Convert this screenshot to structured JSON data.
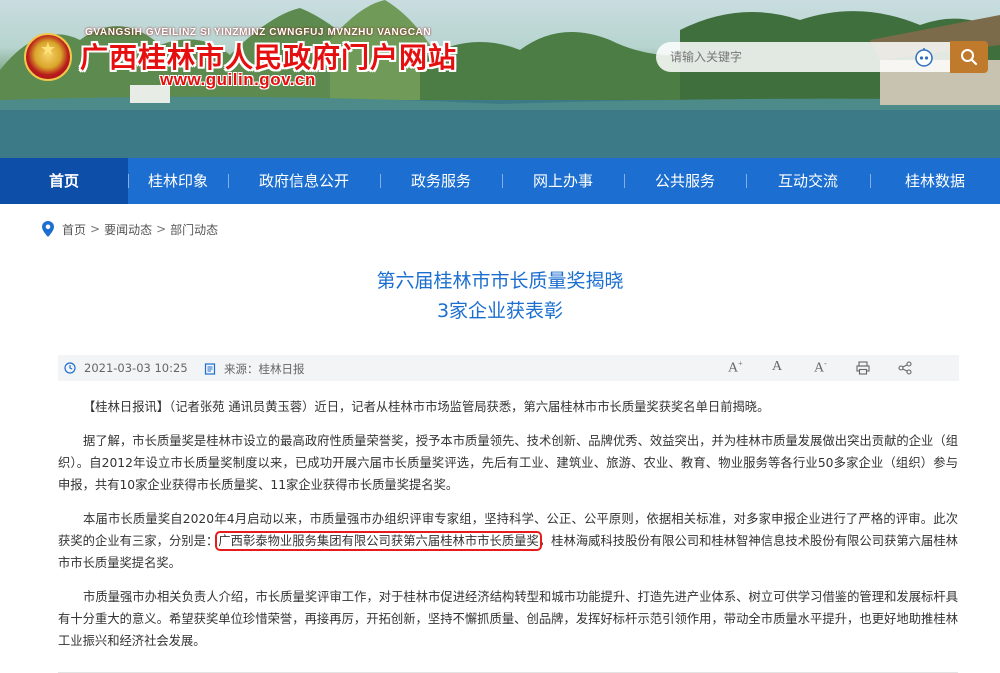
{
  "header": {
    "site_pinyin": "GVANGSIH GVEILINZ SI YINZMINZ CWNGFUJ MVNZHU VANGCAN",
    "site_title": "广西桂林市人民政府门户网站",
    "site_url": "www.guilin.gov.cn",
    "search": {
      "placeholder": "请输入关键字"
    }
  },
  "nav": {
    "items": [
      {
        "label": "首页",
        "active": true
      },
      {
        "label": "桂林印象"
      },
      {
        "label": "政府信息公开"
      },
      {
        "label": "政务服务"
      },
      {
        "label": "网上办事"
      },
      {
        "label": "公共服务"
      },
      {
        "label": "互动交流"
      },
      {
        "label": "桂林数据"
      }
    ]
  },
  "breadcrumb": [
    "首页",
    "要闻动态",
    "部门动态"
  ],
  "article": {
    "title_line1": "第六届桂林市市长质量奖揭晓",
    "title_line2": "3家企业获表彰",
    "date": "2021-03-03 10:25",
    "source": "来源：桂林日报",
    "tools": [
      "A+",
      "A",
      "A-",
      "print-icon",
      "share-icon"
    ],
    "p1": "【桂林日报讯】（记者张苑 通讯员黄玉蓉）近日，记者从桂林市市场监管局获悉，第六届桂林市市长质量奖获奖名单日前揭晓。",
    "p2": "据了解，市长质量奖是桂林市设立的最高政府性质量荣誉奖，授予本市质量领先、技术创新、品牌优秀、效益突出，并为桂林市质量发展做出突出贡献的企业（组织）。自2012年设立市长质量奖制度以来，已成功开展六届市长质量奖评选，先后有工业、建筑业、旅游、农业、教育、物业服务等各行业50多家企业（组织）参与申报，共有10家企业获得市长质量奖、11家企业获得市长质量奖提名奖。",
    "p3_before": "本届市长质量奖自2020年4月启动以来，市质量强市办组织评审专家组，坚持科学、公正、公平原则，依据相关标准，对多家申报企业进行了严格的评审。此次获奖的企业有三家，分别是：",
    "p3_highlight": "广西彰泰物业服务集团有限公司获第六届桂林市市长质量奖",
    "p3_after": "，桂林海威科技股份有限公司和桂林智神信息技术股份有限公司获第六届桂林市市长质量奖提名奖。",
    "p4": "市质量强市办相关负责人介绍，市长质量奖评审工作，对于桂林市促进经济结构转型和城市功能提升、打造先进产业体系、树立可供学习借鉴的管理和发展标杆具有十分重大的意义。希望获奖单位珍惜荣誉，再接再厉，开拓创新，坚持不懈抓质量、创品牌，发挥好标杆示范引领作用，带动全市质量水平提升，也更好地助推桂林工业振兴和经济社会发展。"
  },
  "colors": {
    "nav_bg": "#1c6fd0",
    "nav_active": "#0d4fa8",
    "title_blue": "#1c6fd0",
    "highlight_red": "#e61c1c",
    "search_button": "#c07a2c"
  }
}
